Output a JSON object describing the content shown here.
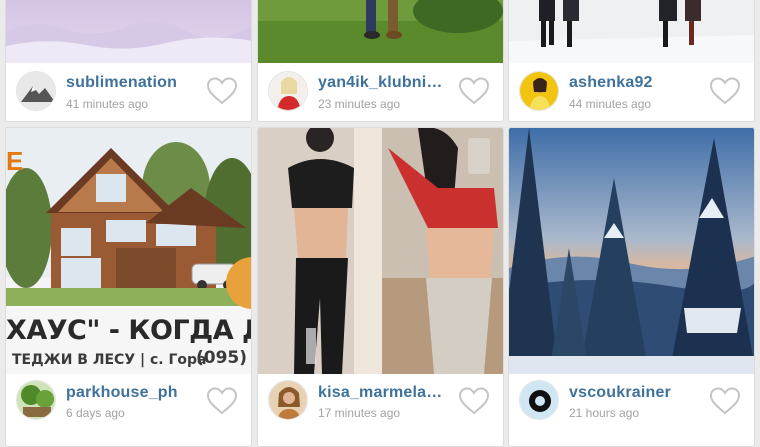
{
  "posts": [
    {
      "username": "sublimenation",
      "time": "41 minutes ago",
      "avatar_icon": "mountain-avatar"
    },
    {
      "username": "yan4ik_klubni…",
      "time": "23 minutes ago",
      "avatar_icon": "woman-red-avatar"
    },
    {
      "username": "ashenka92",
      "time": "44 minutes ago",
      "avatar_icon": "woman-yellow-avatar"
    },
    {
      "username": "parkhouse_ph",
      "time": "6 days ago",
      "avatar_icon": "park-avatar"
    },
    {
      "username": "kisa_marmela…",
      "time": "17 minutes ago",
      "avatar_icon": "woman-avatar"
    },
    {
      "username": "vscoukrainer",
      "time": "21 hours ago",
      "avatar_icon": "vsco-ring-avatar"
    }
  ],
  "house_ad": {
    "tag": "E",
    "headline": "ХАУС\" - КОГДА ДОМ",
    "subline": "ТЕДЖИ В ЛЕСУ | с. Гора",
    "code": "(095)"
  },
  "colors": {
    "username": "#3f729b",
    "time": "#a2a2a2",
    "background": "#ebebeb",
    "heart": "#c4c4c4"
  }
}
